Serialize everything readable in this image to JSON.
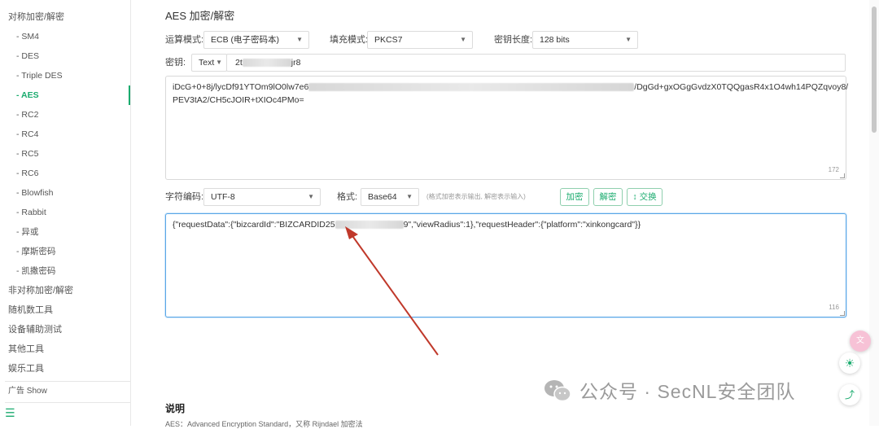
{
  "sidebar": {
    "items": [
      {
        "label": "对称加密/解密",
        "type": "group"
      },
      {
        "label": "- SM4",
        "type": "sub"
      },
      {
        "label": "- DES",
        "type": "sub"
      },
      {
        "label": "- Triple DES",
        "type": "sub"
      },
      {
        "label": "- AES",
        "type": "sub",
        "active": true
      },
      {
        "label": "- RC2",
        "type": "sub"
      },
      {
        "label": "- RC4",
        "type": "sub"
      },
      {
        "label": "- RC5",
        "type": "sub"
      },
      {
        "label": "- RC6",
        "type": "sub"
      },
      {
        "label": "- Blowfish",
        "type": "sub"
      },
      {
        "label": "- Rabbit",
        "type": "sub"
      },
      {
        "label": "- 异或",
        "type": "sub"
      },
      {
        "label": "- 摩斯密码",
        "type": "sub"
      },
      {
        "label": "- 凯撒密码",
        "type": "sub"
      },
      {
        "label": "非对称加密/解密",
        "type": "group"
      },
      {
        "label": "随机数工具",
        "type": "group"
      },
      {
        "label": "设备辅助测试",
        "type": "group"
      },
      {
        "label": "其他工具",
        "type": "group"
      },
      {
        "label": "娱乐工具",
        "type": "group"
      },
      {
        "label": "广告 Show",
        "type": "group"
      }
    ],
    "menu_icon": "hamburger-icon"
  },
  "header": {
    "title": "AES 加密/解密"
  },
  "options": {
    "mode_label": "运算模式:",
    "mode_value": "ECB (电子密码本)",
    "padding_label": "填充模式:",
    "padding_value": "PKCS7",
    "keylen_label": "密钥长度:",
    "keylen_value": "128 bits"
  },
  "key": {
    "label": "密钥:",
    "type_value": "Text",
    "value_prefix": "2t",
    "value_suffix": "jr8"
  },
  "ciphertext": {
    "line1_prefix": "iDcG+0+8j/lycDf91YTOm9lO0lw7e6",
    "line1_suffix": "/DgGd+gxOGgGvdzX0TQQgasR4x1O4wh14PQZqvoy8/",
    "line2": "PEV3tA2/CH5cJOIR+tXIOc4PMo=",
    "count": "172"
  },
  "controls": {
    "encoding_label": "字符编码:",
    "encoding_value": "UTF-8",
    "format_label": "格式:",
    "format_value": "Base64",
    "hint": "(格式加密表示输出, 解密表示输入)",
    "encrypt_label": "加密",
    "decrypt_label": "解密",
    "swap_label": "↕ 交换"
  },
  "plaintext": {
    "prefix": "{\"requestData\":{\"bizcardId\":\"BIZCARDID25",
    "suffix": "9\",\"viewRadius\":1},\"requestHeader\":{\"platform\":\"xinkongcard\"}}",
    "count": "116"
  },
  "description": {
    "title": "说明",
    "text": "AES：Advanced Encryption Standard，又称 Rijndael 加密法"
  },
  "watermark": {
    "text": "公众号 · SecNL安全团队"
  },
  "colors": {
    "accent": "#1aab6e",
    "arrow": "#c0392b",
    "focus": "#5aa7e6"
  }
}
